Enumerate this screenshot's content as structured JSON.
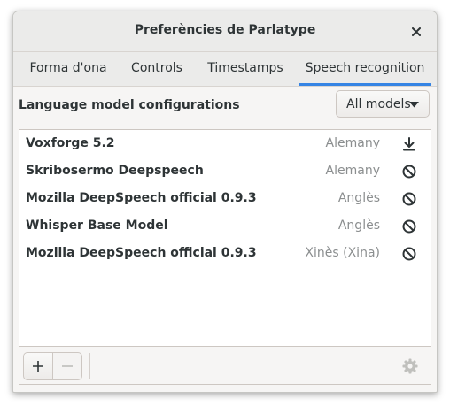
{
  "window": {
    "title": "Preferències de Parlatype"
  },
  "tabs": [
    {
      "label": "Forma d'ona",
      "active": false
    },
    {
      "label": "Controls",
      "active": false
    },
    {
      "label": "Timestamps",
      "active": false
    },
    {
      "label": "Speech recognition",
      "active": true
    }
  ],
  "speech": {
    "section_label": "Language model configurations",
    "filter": {
      "selected": "All models"
    },
    "models": [
      {
        "name": "Voxforge 5.2",
        "language": "Alemany",
        "action_icon": "download-icon"
      },
      {
        "name": "Skribosermo Deepspeech",
        "language": "Alemany",
        "action_icon": "unavailable-icon"
      },
      {
        "name": "Mozilla DeepSpeech official 0.9.3",
        "language": "Anglès",
        "action_icon": "unavailable-icon"
      },
      {
        "name": "Whisper Base Model",
        "language": "Anglès",
        "action_icon": "unavailable-icon"
      },
      {
        "name": "Mozilla DeepSpeech official 0.9.3",
        "language": "Xinès (Xina)",
        "action_icon": "unavailable-icon"
      }
    ]
  },
  "toolbar": {
    "add_icon": "plus-icon",
    "remove_icon": "minus-icon",
    "settings_icon": "gear-icon",
    "remove_enabled": false,
    "settings_enabled": false
  },
  "colors": {
    "accent": "#3584e4",
    "text": "#2e3436",
    "secondary_text": "#8b8e8f",
    "disabled_icon": "#b9b9b6"
  }
}
